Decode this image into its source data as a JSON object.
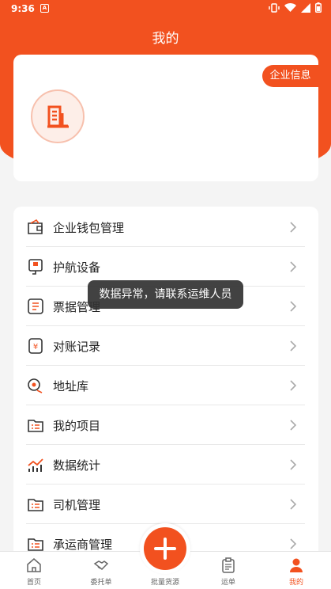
{
  "status_bar": {
    "time": "9:36",
    "notification": "A"
  },
  "header": {
    "title": "我的"
  },
  "profile": {
    "company_info_button": "企业信息"
  },
  "menu": {
    "items": [
      {
        "label": "企业钱包管理",
        "icon": "wallet-icon"
      },
      {
        "label": "护航设备",
        "icon": "device-icon"
      },
      {
        "label": "票据管理",
        "icon": "receipt-icon"
      },
      {
        "label": "对账记录",
        "icon": "reconciliation-icon"
      },
      {
        "label": "地址库",
        "icon": "location-icon"
      },
      {
        "label": "我的项目",
        "icon": "project-icon"
      },
      {
        "label": "数据统计",
        "icon": "statistics-icon"
      },
      {
        "label": "司机管理",
        "icon": "driver-icon"
      },
      {
        "label": "承运商管理",
        "icon": "carrier-icon"
      }
    ]
  },
  "toast": {
    "message": "数据异常，请联系运维人员"
  },
  "bottom_nav": {
    "items": [
      {
        "label": "首页",
        "icon": "home-icon"
      },
      {
        "label": "委托单",
        "icon": "handshake-icon"
      },
      {
        "label": "批量货源",
        "icon": "plus-icon"
      },
      {
        "label": "运单",
        "icon": "clipboard-icon"
      },
      {
        "label": "我的",
        "icon": "person-icon",
        "active": true
      }
    ]
  },
  "colors": {
    "accent": "#f2511f",
    "background": "#f4f4f4"
  }
}
